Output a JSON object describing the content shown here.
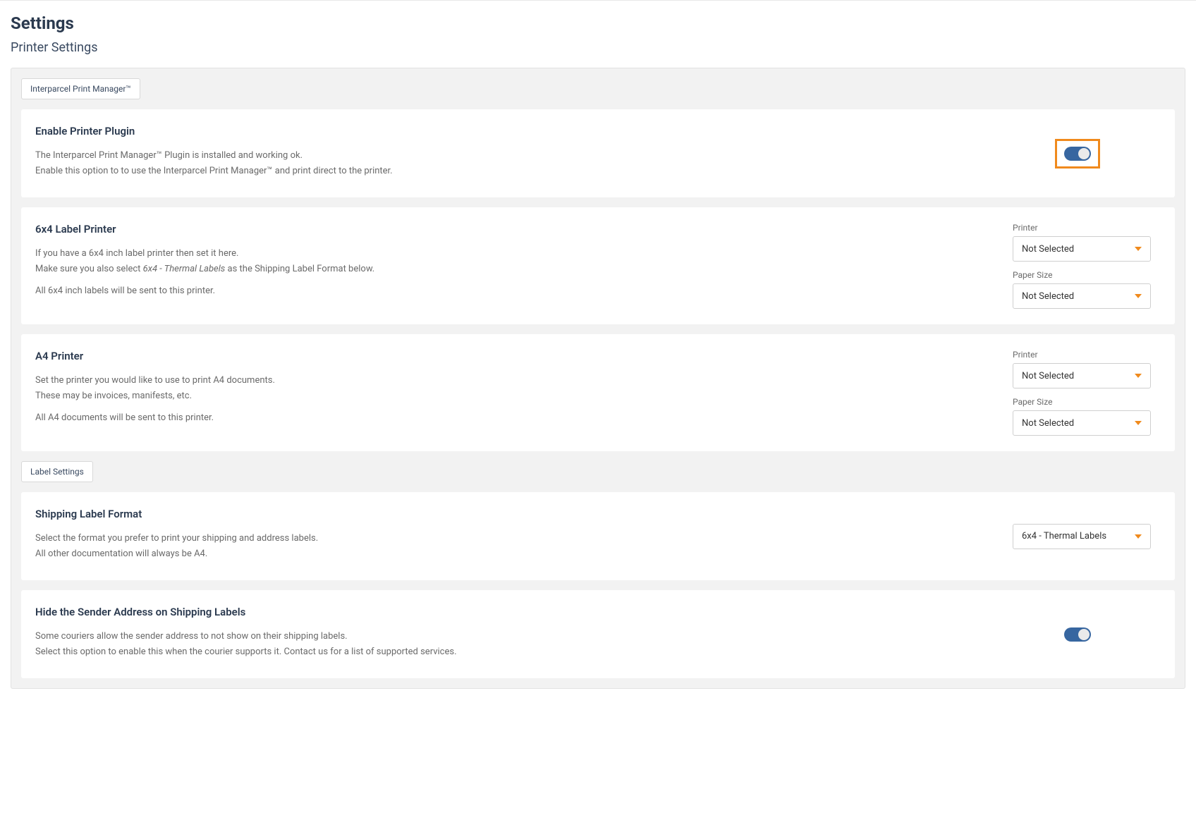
{
  "header": {
    "title": "Settings",
    "subtitle": "Printer Settings"
  },
  "sections": {
    "print_manager_tag": "Interparcel Print Manager™",
    "label_settings_tag": "Label Settings"
  },
  "enable_plugin": {
    "title": "Enable Printer Plugin",
    "desc1": "The Interparcel Print Manager™ Plugin is installed and working ok.",
    "desc2": "Enable this option to to use the Interparcel Print Manager™ and print direct to the printer.",
    "toggle_on": true
  },
  "label_printer": {
    "title": "6x4 Label Printer",
    "desc1": "If you have a 6x4 inch label printer then set it here.",
    "desc2a": "Make sure you also select ",
    "desc2b_italic": "6x4 - Thermal Labels",
    "desc2c": " as the Shipping Label Format below.",
    "desc3": "All 6x4 inch labels will be sent to this printer.",
    "printer_label": "Printer",
    "printer_value": "Not Selected",
    "paper_label": "Paper Size",
    "paper_value": "Not Selected"
  },
  "a4_printer": {
    "title": "A4 Printer",
    "desc1": "Set the printer you would like to use to print A4 documents.",
    "desc2": "These may be invoices, manifests, etc.",
    "desc3": "All A4 documents will be sent to this printer.",
    "printer_label": "Printer",
    "printer_value": "Not Selected",
    "paper_label": "Paper Size",
    "paper_value": "Not Selected"
  },
  "shipping_format": {
    "title": "Shipping Label Format",
    "desc1": "Select the format you prefer to print your shipping and address labels.",
    "desc2": "All other documentation will always be A4.",
    "value": "6x4 - Thermal Labels"
  },
  "hide_sender": {
    "title": "Hide the Sender Address on Shipping Labels",
    "desc1": "Some couriers allow the sender address to not show on their shipping labels.",
    "desc2": "Select this option to enable this when the courier supports it. Contact us for a list of supported services.",
    "toggle_on": true
  }
}
